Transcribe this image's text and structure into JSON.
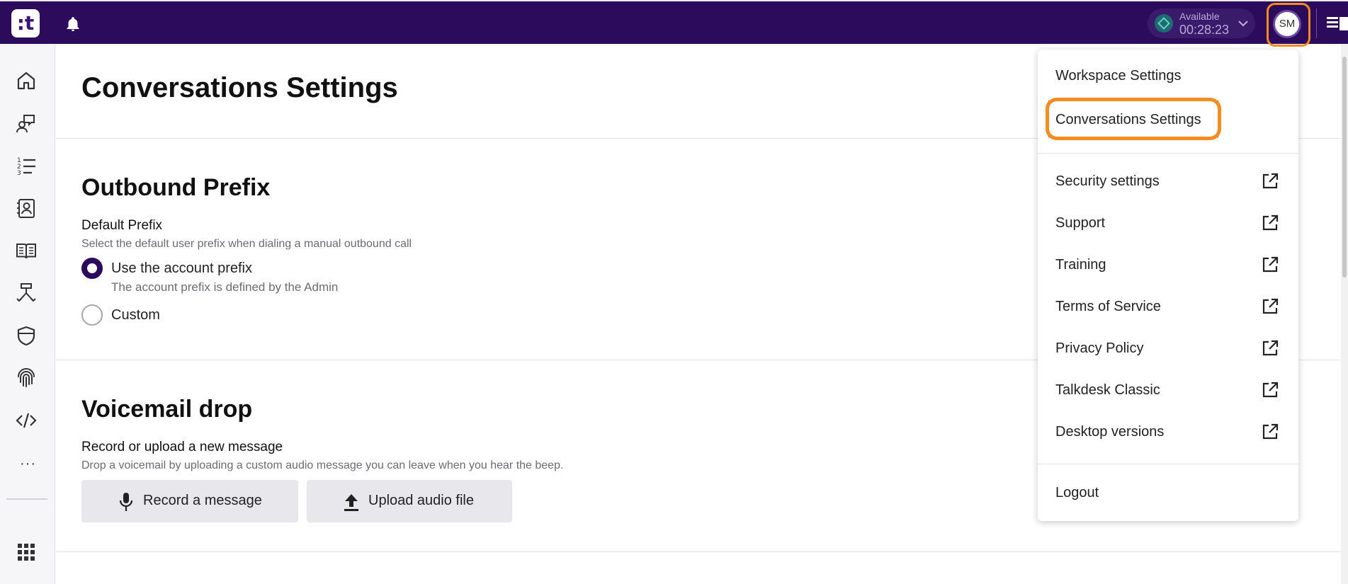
{
  "topbar": {
    "logo_text": ":t",
    "status": {
      "label": "Available",
      "timer": "00:28:23",
      "color": "#1e6a70"
    },
    "avatar_initials": "SM",
    "brand_color": "#2c0a5c",
    "highlight_color": "#f68b1f"
  },
  "sidebar": {
    "items": [
      {
        "name": "home-icon"
      },
      {
        "name": "conversations-icon"
      },
      {
        "name": "list-icon"
      },
      {
        "name": "contacts-icon"
      },
      {
        "name": "knowledge-book-icon"
      },
      {
        "name": "routing-icon"
      },
      {
        "name": "shield-icon"
      },
      {
        "name": "fingerprint-icon"
      },
      {
        "name": "code-icon"
      }
    ],
    "more_label": "···",
    "apps_icon": "grid-icon"
  },
  "page": {
    "title": "Conversations Settings"
  },
  "outbound": {
    "title": "Outbound Prefix",
    "label": "Default Prefix",
    "help": "Select the default user prefix when dialing a manual outbound call",
    "options": [
      {
        "label": "Use the account prefix",
        "sublabel": "The account prefix is defined by the Admin",
        "selected": true
      },
      {
        "label": "Custom",
        "selected": false
      }
    ]
  },
  "voicemail": {
    "title": "Voicemail drop",
    "label": "Record or upload a new message",
    "help": "Drop a voicemail by uploading a custom audio message you can leave when you hear the beep.",
    "record_button": "Record a message",
    "upload_button": "Upload audio file"
  },
  "menu": {
    "items": [
      {
        "label": "Workspace Settings",
        "external": false
      },
      {
        "label": "Conversations Settings",
        "external": false,
        "active": true
      },
      {
        "label": "Security settings",
        "external": true
      },
      {
        "label": "Support",
        "external": true
      },
      {
        "label": "Training",
        "external": true
      },
      {
        "label": "Terms of Service",
        "external": true
      },
      {
        "label": "Privacy Policy",
        "external": true
      },
      {
        "label": "Talkdesk Classic",
        "external": true
      },
      {
        "label": "Desktop versions",
        "external": true
      }
    ],
    "logout": "Logout"
  }
}
